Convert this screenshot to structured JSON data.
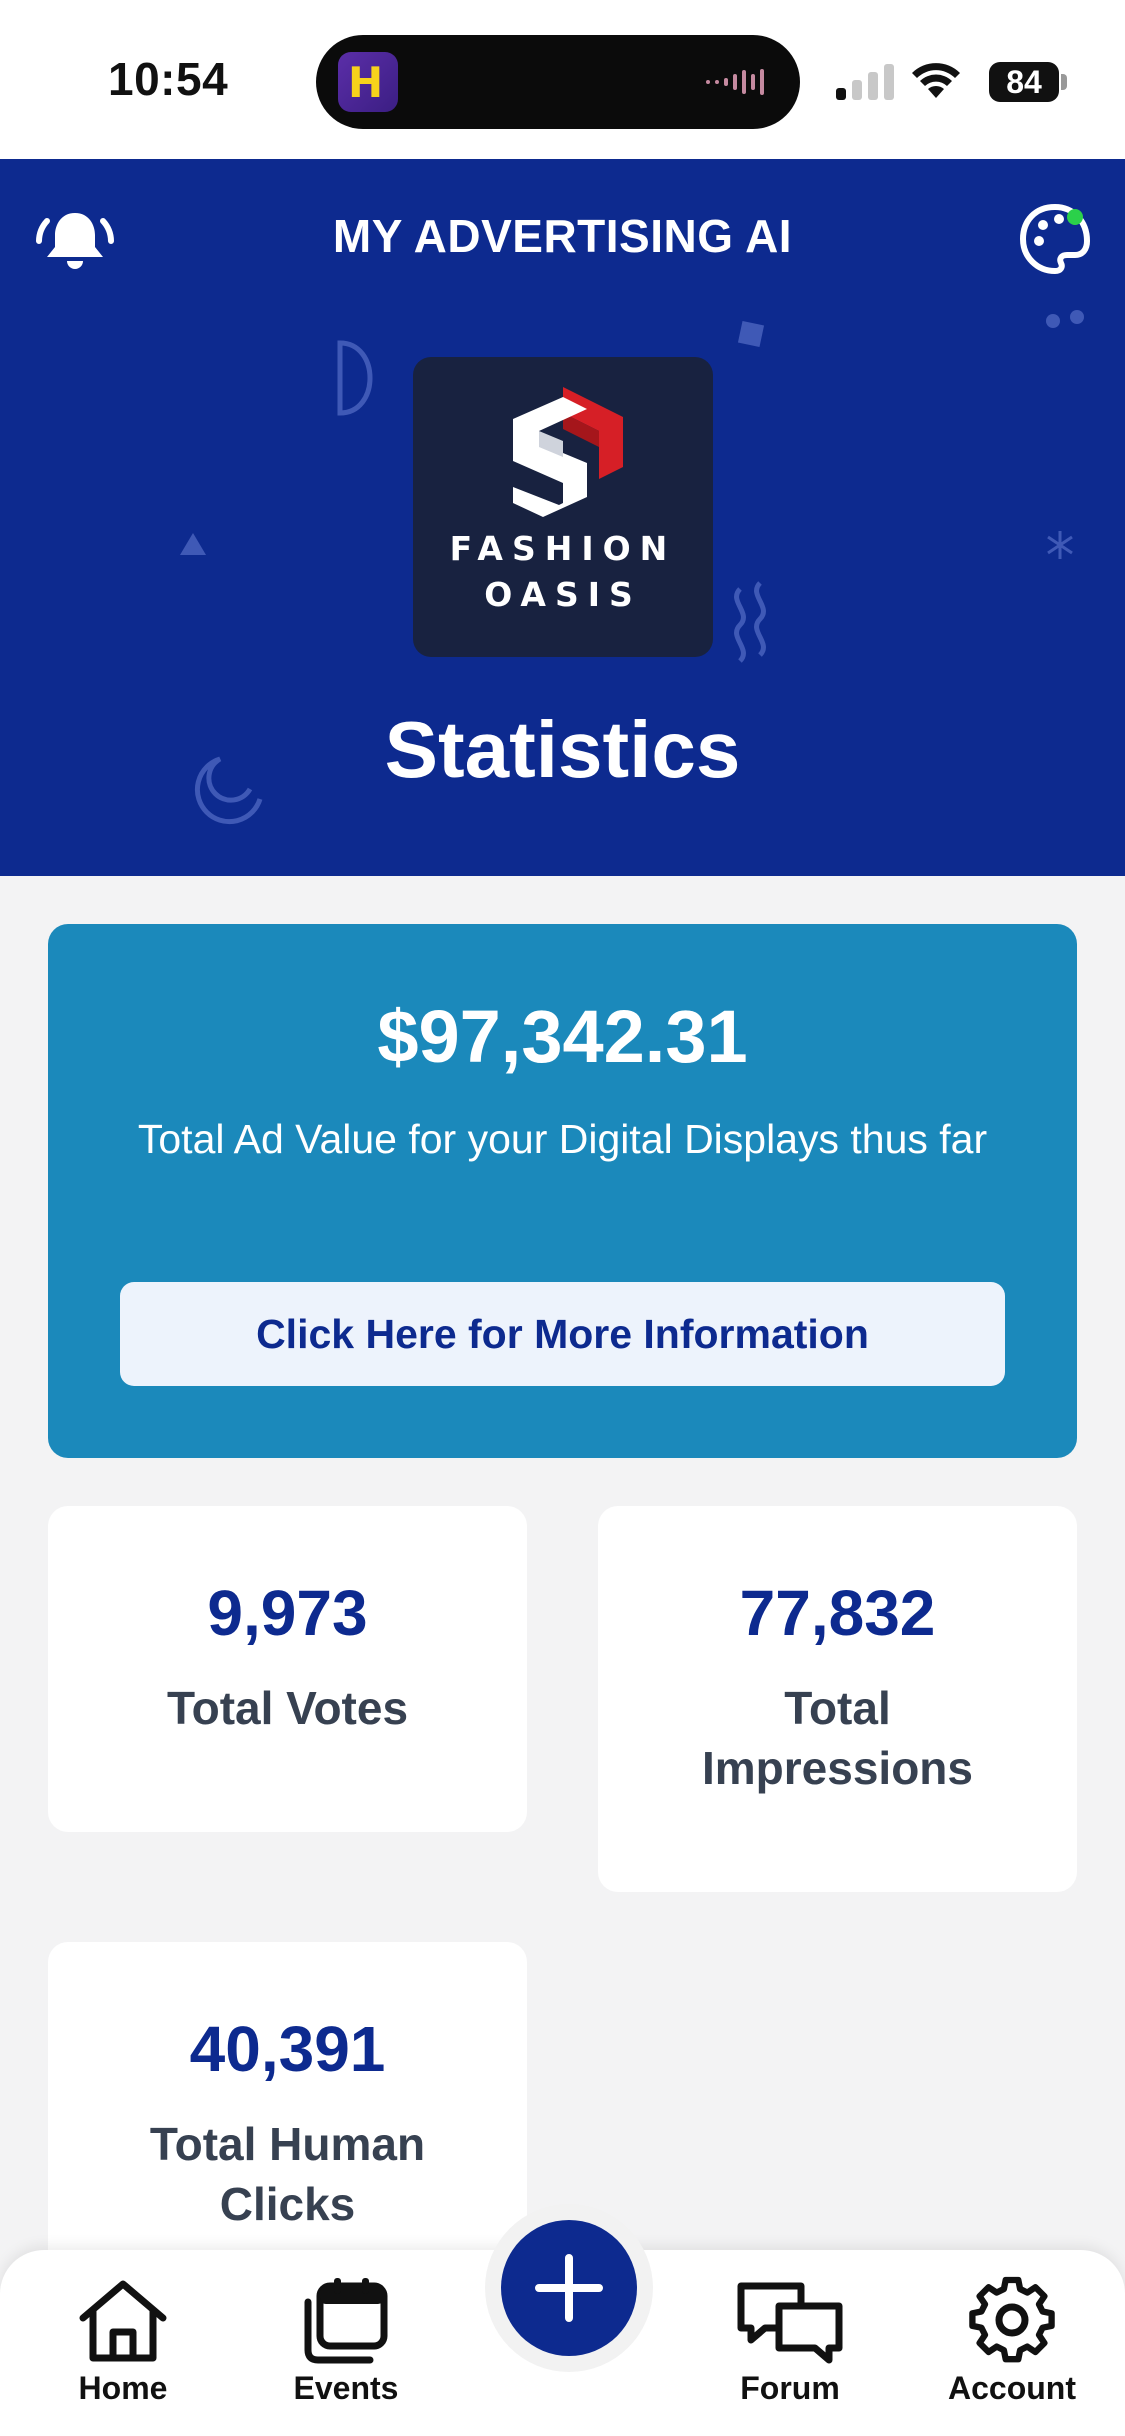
{
  "status_bar": {
    "time": "10:54",
    "battery": "84"
  },
  "header": {
    "app_title": "MY ADVERTISING AI",
    "page_title": "Statistics",
    "brand_color": "#0d2a8f"
  },
  "logo": {
    "line1": "FASHION",
    "line2": "OASIS"
  },
  "value_card": {
    "amount": "$97,342.31",
    "description": "Total Ad Value for your Digital Displays thus far",
    "button_label": "Click Here for More Information",
    "color": "#1b89bb"
  },
  "stats": [
    {
      "value": "9,973",
      "label": "Total Votes"
    },
    {
      "value": "77,832",
      "label": "Total Impressions"
    },
    {
      "value": "40,391",
      "label": "Total Human Clicks"
    }
  ],
  "bottom_nav": {
    "items": [
      {
        "label": "Home",
        "icon": "home-icon"
      },
      {
        "label": "Events",
        "icon": "calendar-icon"
      },
      {
        "label": "Forum",
        "icon": "chat-icon"
      },
      {
        "label": "Account",
        "icon": "gear-icon"
      }
    ],
    "fab_icon": "plus-icon"
  }
}
